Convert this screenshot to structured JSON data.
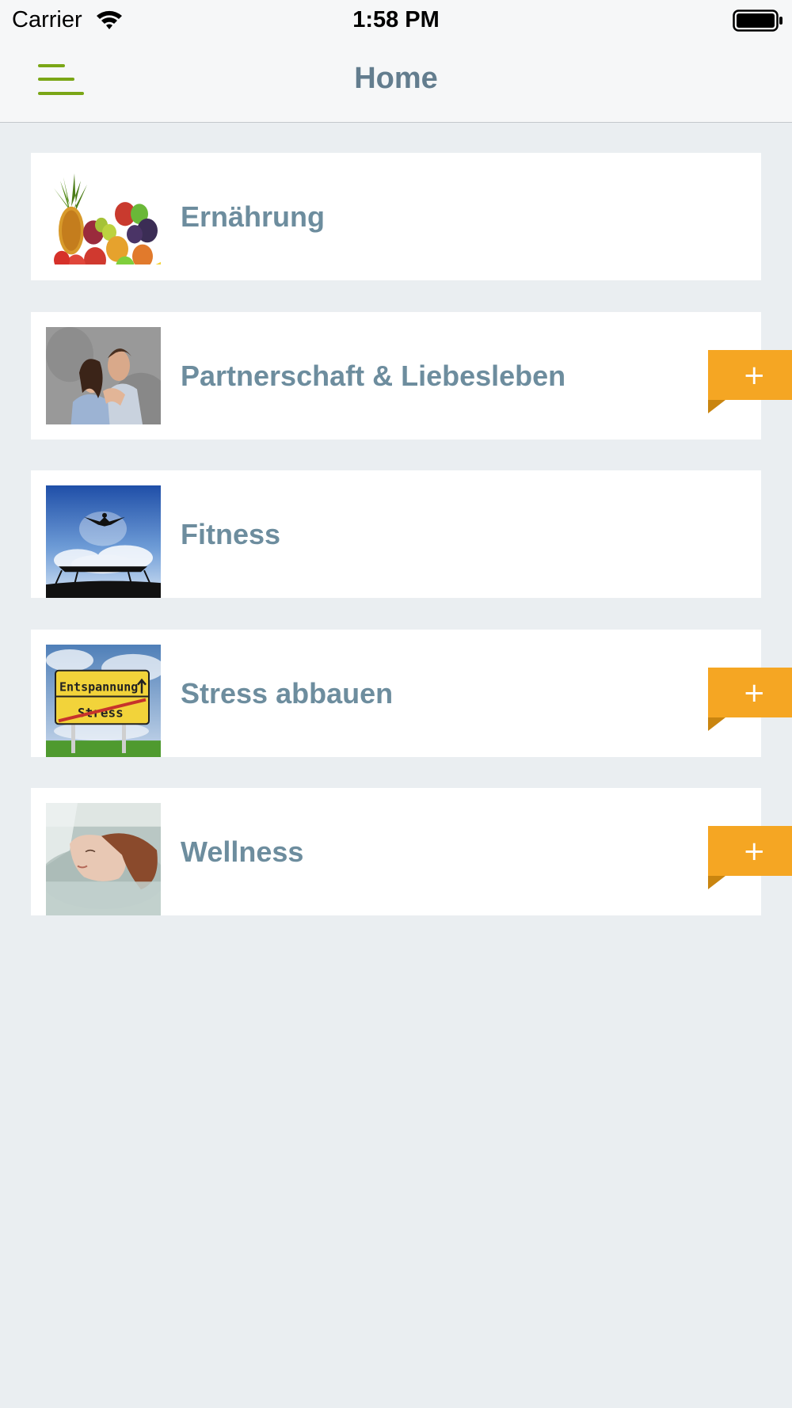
{
  "status_bar": {
    "carrier": "Carrier",
    "time": "1:58 PM"
  },
  "nav_bar": {
    "title": "Home",
    "menu_icon": "hamburger-menu-icon",
    "accent_color": "#7aa616"
  },
  "categories": [
    {
      "label": "Ernährung",
      "has_add_button": false,
      "image": "fruit-basket"
    },
    {
      "label": "Partnerschaft & Liebesleben",
      "has_add_button": true,
      "image": "embracing-couple"
    },
    {
      "label": "Fitness",
      "has_add_button": false,
      "image": "trampoline-jumper"
    },
    {
      "label": "Stress abbauen",
      "has_add_button": true,
      "image": "road-sign-stress",
      "image_text": [
        "Entspannung",
        "Stress"
      ]
    },
    {
      "label": "Wellness",
      "has_add_button": true,
      "image": "woman-in-bath"
    }
  ],
  "add_button": {
    "symbol": "+",
    "color": "#f5a623"
  },
  "colors": {
    "background": "#eaeef1",
    "card": "#ffffff",
    "label": "#6d8d9e",
    "title": "#637d8e"
  }
}
